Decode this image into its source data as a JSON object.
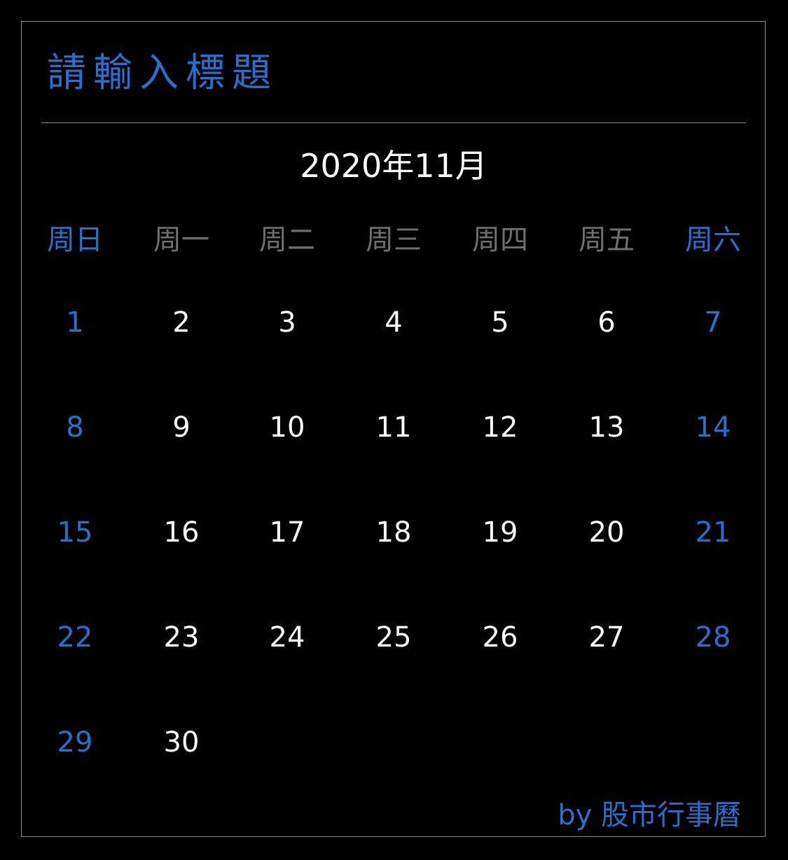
{
  "title": "請輸入標題",
  "month_label": "2020年11月",
  "weekdays": [
    "周日",
    "周一",
    "周二",
    "周三",
    "周四",
    "周五",
    "周六"
  ],
  "weeks": [
    [
      "1",
      "2",
      "3",
      "4",
      "5",
      "6",
      "7"
    ],
    [
      "8",
      "9",
      "10",
      "11",
      "12",
      "13",
      "14"
    ],
    [
      "15",
      "16",
      "17",
      "18",
      "19",
      "20",
      "21"
    ],
    [
      "22",
      "23",
      "24",
      "25",
      "26",
      "27",
      "28"
    ],
    [
      "29",
      "30",
      "",
      "",
      "",
      "",
      ""
    ]
  ],
  "footer": "by 股市行事曆",
  "colors": {
    "background": "#000000",
    "weekend": "#2a6fc9",
    "weekday_header": "#6f6f6f",
    "date_text": "#ffffff",
    "border": "#8e8e8e"
  }
}
